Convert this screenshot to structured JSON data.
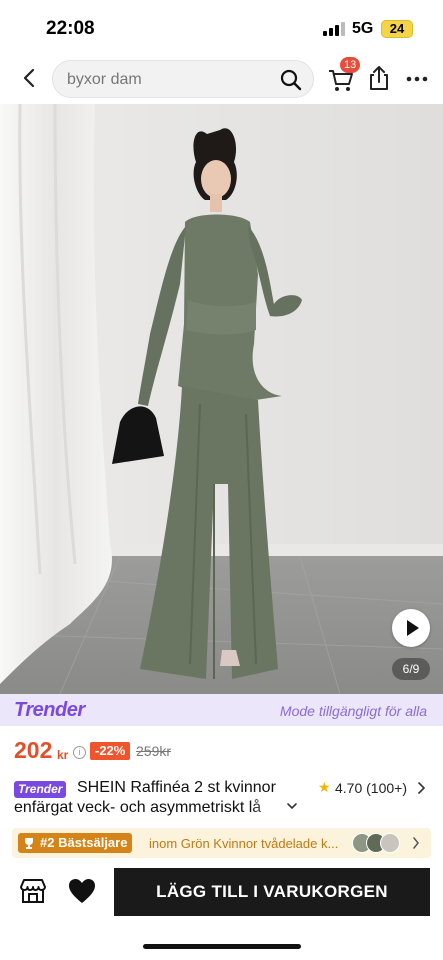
{
  "status_bar": {
    "time": "22:08",
    "network": "5G",
    "battery": "24"
  },
  "header": {
    "search_placeholder": "byxor dam",
    "cart_count": "13",
    "icons": [
      "back-arrow-icon",
      "search-icon",
      "cart-icon",
      "share-icon",
      "more-dots-icon"
    ]
  },
  "gallery": {
    "image_counter": "6/9",
    "has_video": true
  },
  "trender": {
    "logo": "Trender",
    "slogan": "Mode tillgängligt för alla"
  },
  "pricing": {
    "price": "202",
    "currency": "kr",
    "discount": "-22%",
    "original_price": "259kr",
    "price_color": "#e0512b"
  },
  "product": {
    "badge": "Trender",
    "title_line1": "SHEIN Raffinéa 2 st kvinnor",
    "title_line2": "enfärgat veck- och asymmetriskt lå",
    "rating": "4.70 (100+)"
  },
  "bestseller": {
    "badge": "#2 Bästsäljare",
    "text": "inom Grön Kvinnor tvådelade k..."
  },
  "actions": {
    "add_to_cart": "LÄGG TILL I VARUKORGEN"
  },
  "colors": {
    "accent_purple": "#7a4ae0",
    "button_dark": "#1a1a1a",
    "bestseller_orange": "#d48418"
  }
}
